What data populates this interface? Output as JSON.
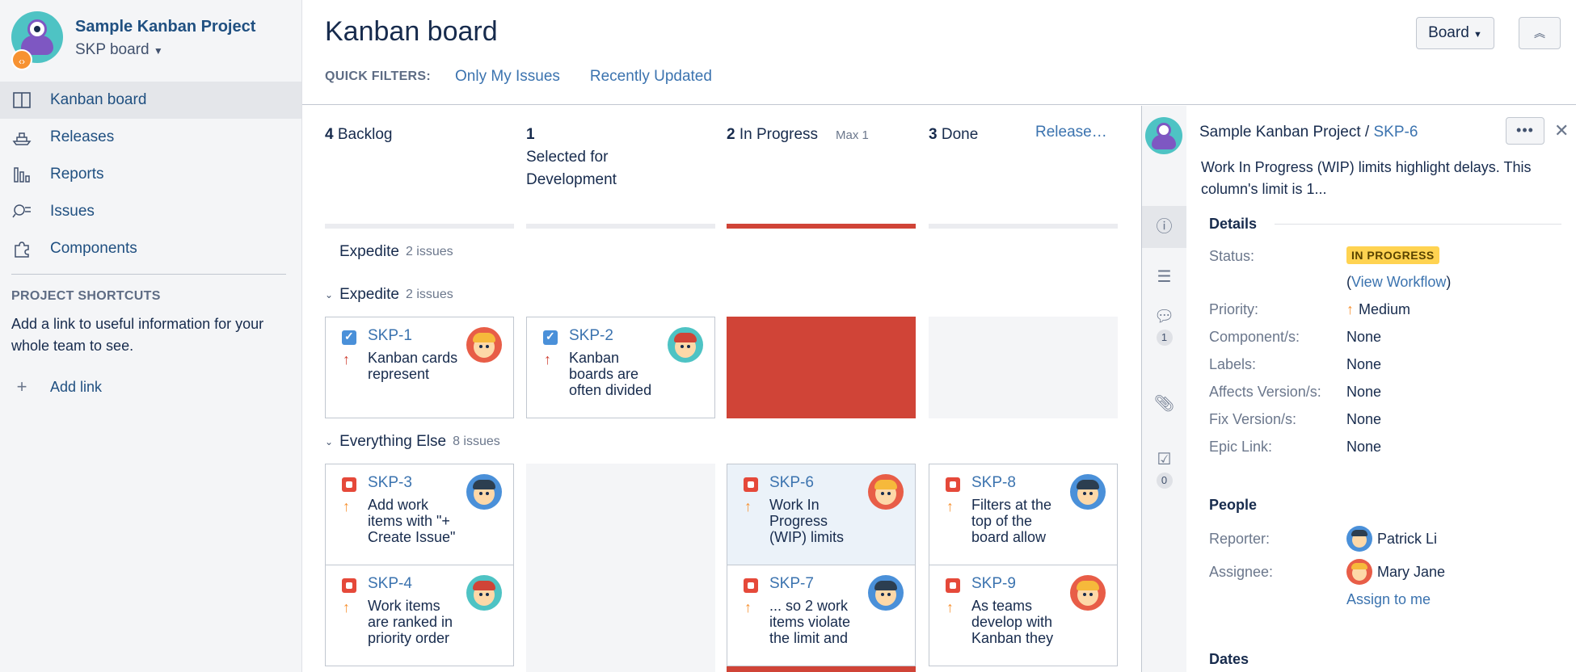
{
  "sidebar": {
    "project_name": "Sample Kanban Project",
    "board_name": "SKP board",
    "nav": [
      {
        "label": "Kanban board",
        "icon": "board-icon"
      },
      {
        "label": "Releases",
        "icon": "ship-icon"
      },
      {
        "label": "Reports",
        "icon": "chart-icon"
      },
      {
        "label": "Issues",
        "icon": "search-list-icon"
      },
      {
        "label": "Components",
        "icon": "puzzle-icon"
      }
    ],
    "shortcuts_title": "PROJECT SHORTCUTS",
    "shortcuts_text": "Add a link to useful information for your whole team to see.",
    "add_link": "Add link"
  },
  "header": {
    "title": "Kanban board",
    "quick_filters_label": "QUICK FILTERS:",
    "filters": [
      "Only My Issues",
      "Recently Updated"
    ],
    "board_button": "Board"
  },
  "board": {
    "columns": [
      {
        "count": "4",
        "name": "Backlog",
        "max": ""
      },
      {
        "count": "1",
        "name": "Selected for Development",
        "max": ""
      },
      {
        "count": "2",
        "name": "In Progress",
        "max": "Max 1"
      },
      {
        "count": "3",
        "name": "Done",
        "max": ""
      }
    ],
    "release_link": "Release…",
    "swimlanes": [
      {
        "name": "Expedite",
        "count": "2 issues"
      },
      {
        "name": "Expedite",
        "count": "2 issues"
      },
      {
        "name": "Everything Else",
        "count": "8 issues"
      }
    ],
    "cards": [
      {
        "key": "SKP-1",
        "summary": "Kanban cards represent",
        "type": "task",
        "priority": "high",
        "avatar_color": "#e85d47",
        "hair": "#f6b93b"
      },
      {
        "key": "SKP-2",
        "summary": "Kanban boards are often divided",
        "type": "task",
        "priority": "high",
        "avatar_color": "#4ec3c4",
        "hair": "#d04437"
      },
      {
        "key": "SKP-3",
        "summary": "Add work items with \"+ Create Issue\"",
        "type": "bug",
        "priority": "med",
        "avatar_color": "#4a90d9",
        "hair": "#2c3e50"
      },
      {
        "key": "SKP-6",
        "summary": "Work In Progress (WIP) limits",
        "type": "bug",
        "priority": "med",
        "avatar_color": "#e85d47",
        "hair": "#f6b93b"
      },
      {
        "key": "SKP-8",
        "summary": "Filters at the top of the board allow",
        "type": "bug",
        "priority": "med",
        "avatar_color": "#4a90d9",
        "hair": "#2c3e50"
      },
      {
        "key": "SKP-4",
        "summary": "Work items are ranked in priority order",
        "type": "bug",
        "priority": "med",
        "avatar_color": "#4ec3c4",
        "hair": "#d04437"
      },
      {
        "key": "SKP-7",
        "summary": "... so 2 work items violate the limit and",
        "type": "bug",
        "priority": "med",
        "avatar_color": "#4a90d9",
        "hair": "#2c3e50"
      },
      {
        "key": "SKP-9",
        "summary": "As teams develop with Kanban they",
        "type": "bug",
        "priority": "med",
        "avatar_color": "#e85d47",
        "hair": "#f6b93b"
      }
    ]
  },
  "panel": {
    "project": "Sample Kanban Project",
    "separator": "/",
    "issue_key": "SKP-6",
    "more": "•••",
    "description": "Work In Progress (WIP) limits highlight delays. This column's limit is 1...",
    "comment_count": "1",
    "checklist_count": "0",
    "details_title": "Details",
    "status_label": "Status:",
    "status_value": "IN PROGRESS",
    "view_workflow": "View Workflow",
    "paren_open": "(",
    "paren_close": ")",
    "priority_label": "Priority:",
    "priority_value": "Medium",
    "components_label": "Component/s:",
    "components_value": "None",
    "labels_label": "Labels:",
    "labels_value": "None",
    "affects_label": "Affects Version/s:",
    "affects_value": "None",
    "fix_label": "Fix Version/s:",
    "fix_value": "None",
    "epic_label": "Epic Link:",
    "epic_value": "None",
    "people_title": "People",
    "reporter_label": "Reporter:",
    "reporter_value": "Patrick Li",
    "assignee_label": "Assignee:",
    "assignee_value": "Mary Jane",
    "assign_to_me": "Assign to me",
    "dates_title": "Dates"
  }
}
